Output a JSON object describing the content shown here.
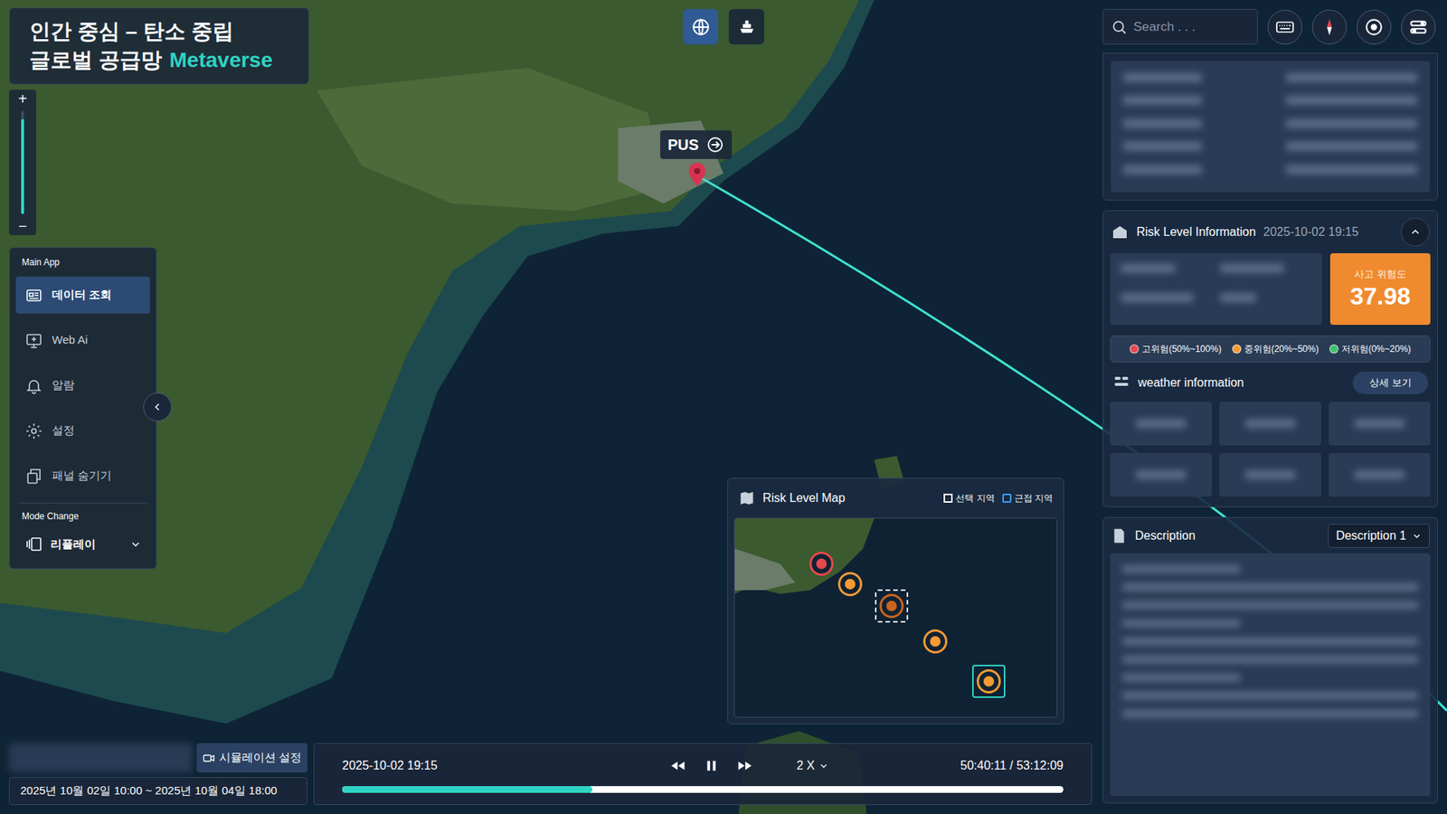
{
  "title": {
    "line1": "인간 중심 – 탄소 중립",
    "line2": "글로벌 공급망",
    "highlight": "Metaverse"
  },
  "view_toggle": [
    {
      "selected": true
    },
    {
      "selected": false
    }
  ],
  "zoom": {
    "plus": "+",
    "minus": "−",
    "level": 0.92
  },
  "sidebar": {
    "section": "Main App",
    "items": [
      {
        "label": "데이터 조회",
        "selected": true
      },
      {
        "label": "Web Ai",
        "selected": false
      },
      {
        "label": "알람",
        "selected": false
      },
      {
        "label": "설정",
        "selected": false
      },
      {
        "label": "패널 숨기기",
        "selected": false
      }
    ],
    "mode_section": "Mode Change",
    "mode": {
      "label": "리플레이",
      "expanded": false
    }
  },
  "search": {
    "placeholder": "Search . . ."
  },
  "map": {
    "pin": {
      "label": "PUS"
    }
  },
  "risk_info": {
    "title": "Risk Level Information",
    "time": "2025-10-02 19:15",
    "expanded": true,
    "score_label": "사고 위험도",
    "score": "37.98",
    "score_color": "#f08a2e",
    "legend": [
      {
        "label": "고위험(50%~100%)",
        "color": "#e5484d"
      },
      {
        "label": "중위험(20%~50%)",
        "color": "#f39a35"
      },
      {
        "label": "저위험(0%~20%)",
        "color": "#3fbf6a"
      }
    ],
    "weather_title": "weather information",
    "detail_button": "상세 보기"
  },
  "description": {
    "title": "Description",
    "selected": "Description 1"
  },
  "risk_map": {
    "title": "Risk Level Map",
    "filters": [
      {
        "label": "선택 지역",
        "kind": "selection"
      },
      {
        "label": "근접 지역",
        "kind": "checkbox",
        "checked": false
      }
    ],
    "markers": [
      {
        "color": "#e5484d",
        "selected": false,
        "focused": false
      },
      {
        "color": "#f39a35",
        "selected": false,
        "focused": false
      },
      {
        "color": "#c8651f",
        "selected": true,
        "focused": false
      },
      {
        "color": "#f39a35",
        "selected": false,
        "focused": false
      },
      {
        "color": "#f39a35",
        "selected": false,
        "focused": true
      }
    ]
  },
  "simulation": {
    "button": "시뮬레이션 설정",
    "range": "2025년 10월 02일 10:00 ~ 2025년 10월 04일 18:00"
  },
  "playback": {
    "time": "2025-10-02 19:15",
    "playing": true,
    "speed": "2 X",
    "elapsed": "50:40:11 / 53:12:09",
    "level": 0.347
  }
}
